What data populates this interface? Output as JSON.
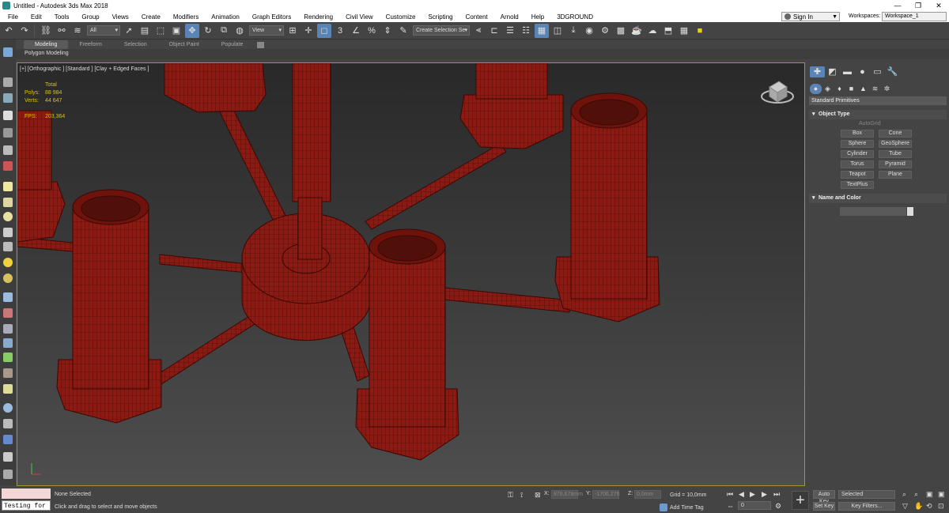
{
  "window": {
    "title": "Untitled - Autodesk 3ds Max 2018"
  },
  "menu": {
    "items": [
      "File",
      "Edit",
      "Tools",
      "Group",
      "Views",
      "Create",
      "Modifiers",
      "Animation",
      "Graph Editors",
      "Rendering",
      "Civil View",
      "Customize",
      "Scripting",
      "Content",
      "Arnold",
      "Help",
      "3DGROUND"
    ],
    "sign_in": "Sign In",
    "workspaces_label": "Workspaces:",
    "workspace_value": "Workspace_1"
  },
  "toolbar": {
    "filter_value": "All",
    "refcoord_value": "View",
    "named_selection_placeholder": "Create Selection Se"
  },
  "ribbon": {
    "tabs": [
      "Modeling",
      "Freeform",
      "Selection",
      "Object Paint",
      "Populate"
    ],
    "active_panel": "Polygon Modeling"
  },
  "viewport": {
    "label": "[+] [Orthographic ] [Standard ] [Clay + Edged Faces ]",
    "stats_header": "Total",
    "polys_label": "Polys:",
    "polys_value": "88 984",
    "verts_label": "Verts:",
    "verts_value": "44 647",
    "fps_label": "FPS:",
    "fps_value": "203,364",
    "object_color": "#8b1a12"
  },
  "command_panel": {
    "category": "Standard Primitives",
    "object_type_title": "Object Type",
    "autogrid_label": "AutoGrid",
    "buttons": [
      "Box",
      "Cone",
      "Sphere",
      "GeoSphere",
      "Cylinder",
      "Tube",
      "Torus",
      "Pyramid",
      "Teapot",
      "Plane",
      "TextPlus"
    ],
    "name_color_title": "Name and Color"
  },
  "status": {
    "maxscript_text": "Testing for :",
    "selection_text": "None Selected",
    "prompt_text": "Click and drag to select and move objects",
    "x_label": "X:",
    "x_value": "878,678mm",
    "y_label": "Y:",
    "y_value": "-1706,276",
    "z_label": "Z:",
    "z_value": "0,0mm",
    "grid_text": "Grid = 10,0mm",
    "add_time_tag": "Add Time Tag",
    "frame_value": "0",
    "auto_key": "Auto Key",
    "set_key": "Set Key",
    "key_mode_value": "Selected",
    "key_filters": "Key Filters..."
  },
  "accent_colors": {
    "active_blue": "#5b84b6",
    "stats_yellow": "#e0c000",
    "viewport_border": "#b09030"
  }
}
